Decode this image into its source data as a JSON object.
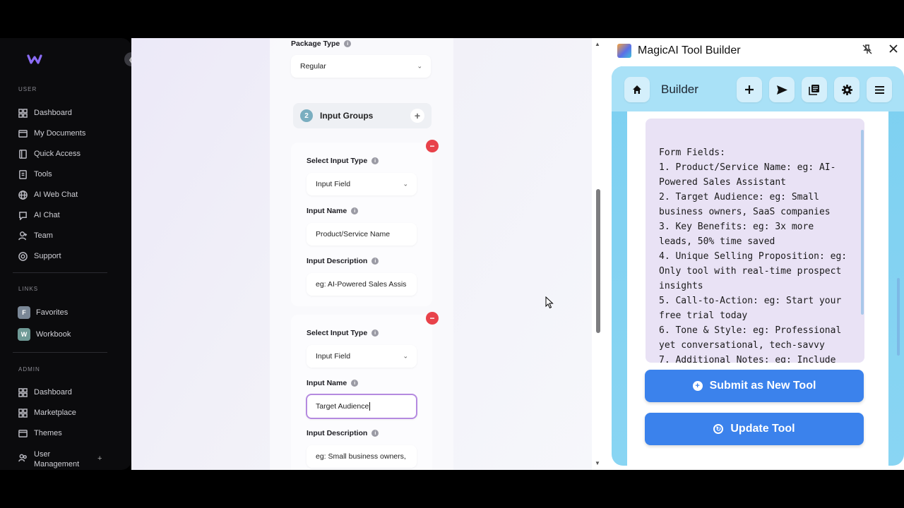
{
  "sidebar": {
    "section_user": "USER",
    "user_items": [
      "Dashboard",
      "My Documents",
      "Quick Access",
      "Tools",
      "AI Web Chat",
      "AI Chat",
      "Team",
      "Support"
    ],
    "section_links": "LINKS",
    "links": [
      {
        "badge": "F",
        "label": "Favorites",
        "color": "#7a8796"
      },
      {
        "badge": "W",
        "label": "Workbook",
        "color": "#6f9a96"
      }
    ],
    "section_admin": "ADMIN",
    "admin_items": [
      "Dashboard",
      "Marketplace",
      "Themes",
      "User Management"
    ],
    "user_management_plus": "+"
  },
  "form": {
    "package_type_label": "Package Type",
    "package_type_value": "Regular",
    "group_number": "2",
    "group_title": "Input Groups",
    "group_add": "+",
    "remove_symbol": "−",
    "groups": [
      {
        "select_type_label": "Select Input Type",
        "select_type_value": "Input Field",
        "name_label": "Input Name",
        "name_value": "Product/Service Name",
        "desc_label": "Input Description",
        "desc_value": "eg: AI-Powered Sales Assis"
      },
      {
        "select_type_label": "Select Input Type",
        "select_type_value": "Input Field",
        "name_label": "Input Name",
        "name_value": "Target Audience",
        "desc_label": "Input Description",
        "desc_value": "eg: Small business owners,"
      }
    ]
  },
  "panel": {
    "title": "MagicAI Tool Builder",
    "builder_title": "Builder",
    "textarea_text": "Form Fields:\n1. Product/Service Name: eg: AI-Powered Sales Assistant\n2. Target Audience: eg: Small business owners, SaaS companies\n3. Key Benefits: eg: 3x more leads, 50% time saved\n4. Unique Selling Proposition: eg: Only tool with real-time prospect insights\n5. Call-to-Action: eg: Start your free trial today\n6. Tone & Style: eg: Professional yet conversational, tech-savvy\n7. Additional Notes: eg: Include",
    "submit_label": "Submit as New Tool",
    "update_label": "Update Tool"
  },
  "colors": {
    "accent_blue": "#3b82ec",
    "remove_red": "#e8424a",
    "active_border": "#b58ae0"
  }
}
